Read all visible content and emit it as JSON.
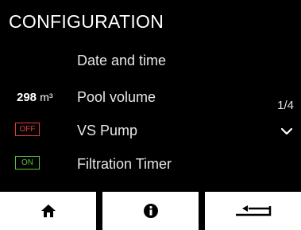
{
  "header": {
    "title": "CONFIGURATION"
  },
  "menu": {
    "items": [
      {
        "label": "Date and time"
      },
      {
        "label": "Pool volume",
        "value": "298",
        "unit": "m³"
      },
      {
        "label": "VS Pump",
        "badge": "OFF"
      },
      {
        "label": "Filtration Timer",
        "badge": "ON"
      }
    ]
  },
  "pager": {
    "text": "1/4",
    "scroll_icon": "chevron-down-icon"
  },
  "footer": {
    "buttons": [
      {
        "icon": "home-icon"
      },
      {
        "icon": "info-icon"
      },
      {
        "icon": "back-arrow-icon"
      }
    ]
  },
  "colors": {
    "background": "#000000",
    "off_badge": "#e23b3b",
    "on_badge": "#5cbf3d",
    "footer_button": "#ffffff"
  }
}
